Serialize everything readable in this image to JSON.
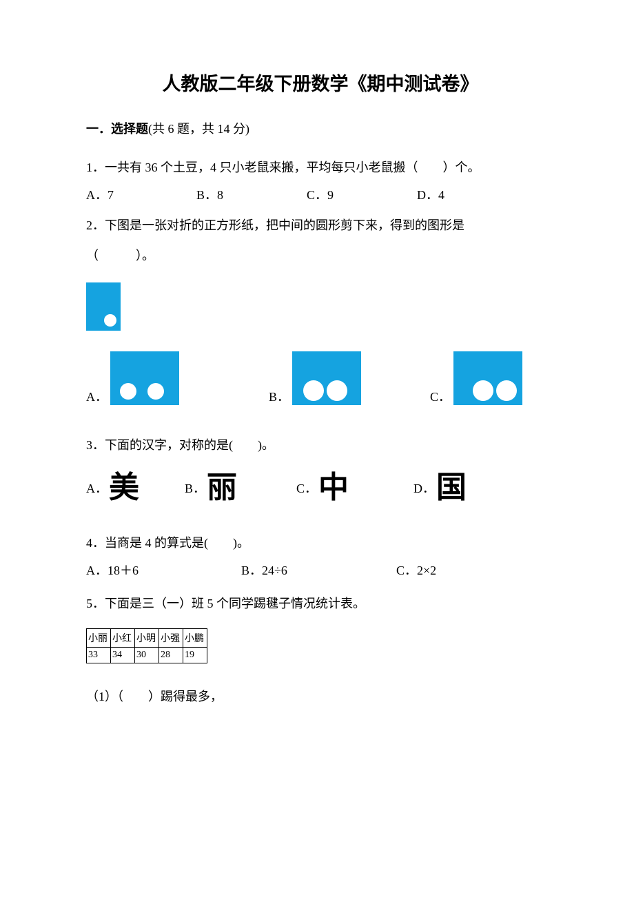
{
  "title": "人教版二年级下册数学《期中测试卷》",
  "section1": {
    "label": "一．选择题",
    "info": "(共 6 题，共 14 分)"
  },
  "q1": {
    "text": "1．一共有 36 个土豆，4 只小老鼠来搬，平均每只小老鼠搬（　　）个。",
    "A": "A．7",
    "B": "B．8",
    "C": "C．9",
    "D": "D．4"
  },
  "q2": {
    "line1": "2．下图是一张对折的正方形纸，把中间的圆形剪下来，得到的图形是",
    "line2": "（　　　）。",
    "A": "A．",
    "B": "B．",
    "C": "C．"
  },
  "q3": {
    "text": "3．下面的汉字，对称的是(　　)。",
    "A": "A．",
    "Achar": "美",
    "B": "B．",
    "Bchar": "丽",
    "C": "C．",
    "Cchar": "中",
    "D": "D．",
    "Dchar": "国"
  },
  "q4": {
    "text": "4．当商是 4 的算式是(　　)。",
    "A": "A．18＋6",
    "B": "B．24÷6",
    "C": "C．2×2"
  },
  "q5": {
    "text": "5．下面是三（一）班 5 个同学踢毽子情况统计表。",
    "headers": [
      "小丽",
      "小红",
      "小明",
      "小强",
      "小鹏"
    ],
    "values": [
      "33",
      "34",
      "30",
      "28",
      "19"
    ],
    "sub1": "（1）（　　）踢得最多，"
  }
}
